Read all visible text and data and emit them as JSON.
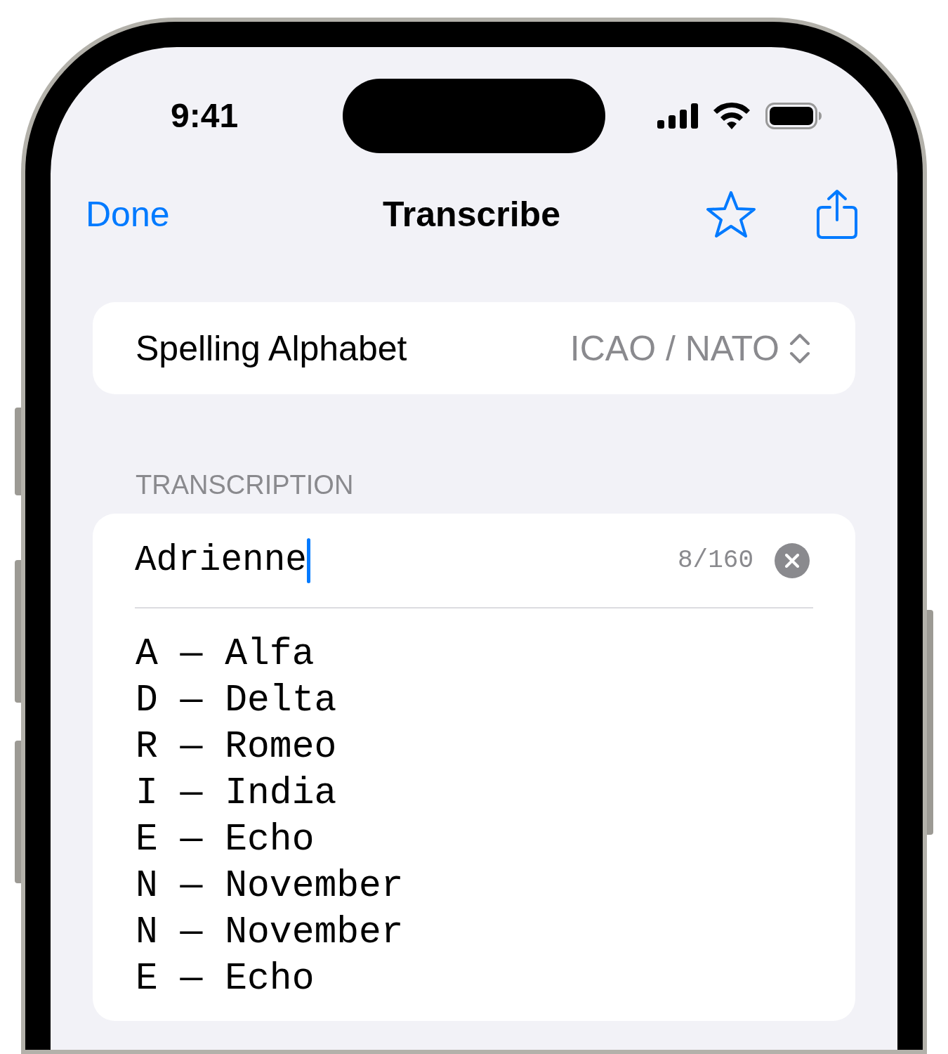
{
  "status_bar": {
    "time": "9:41"
  },
  "nav_bar": {
    "done": "Done",
    "title": "Transcribe",
    "favorite": {
      "selected": false
    }
  },
  "picker": {
    "label": "Spelling Alphabet",
    "value": "ICAO / NATO"
  },
  "section_header": "TRANSCRIPTION",
  "input": {
    "value": "Adrienne",
    "focused": true,
    "counter": "8/160"
  },
  "transcription": [
    {
      "text": "A — Alfa"
    },
    {
      "text": "D — Delta"
    },
    {
      "text": "R — Romeo"
    },
    {
      "text": "I — India"
    },
    {
      "text": "E — Echo"
    },
    {
      "text": "N — November"
    },
    {
      "text": "N — November"
    },
    {
      "text": "E — Echo"
    }
  ]
}
